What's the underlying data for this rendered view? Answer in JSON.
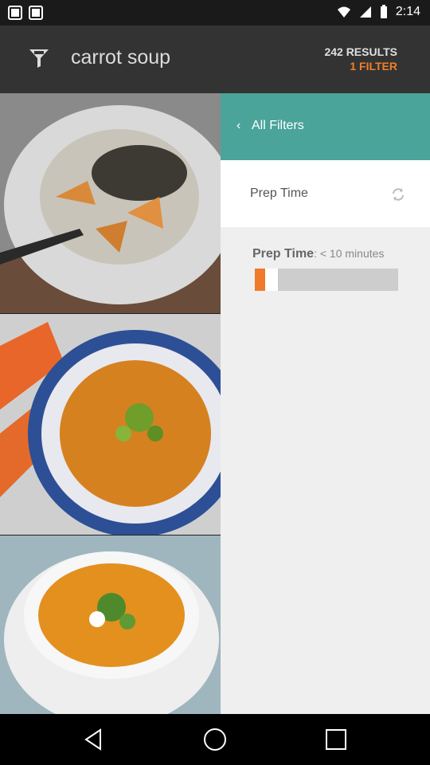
{
  "status_bar": {
    "time": "2:14"
  },
  "app_bar": {
    "query": "carrot soup",
    "results_count": "242 RESULTS",
    "filter_count": "1 FILTER",
    "accent": "#f07e2a"
  },
  "images": [
    {
      "name": "soup-photo-1"
    },
    {
      "name": "soup-photo-2"
    },
    {
      "name": "soup-photo-3"
    }
  ],
  "panel": {
    "header_label": "All Filters",
    "header_color": "#4aa49a",
    "filter_row_label": "Prep Time",
    "detail_label": "Prep Time",
    "detail_value": ": < 10 minutes",
    "slider_value_fraction": 0.07
  },
  "icons": {
    "filter": "filter-icon",
    "refresh": "refresh-icon",
    "back": "chevron-left-icon"
  }
}
